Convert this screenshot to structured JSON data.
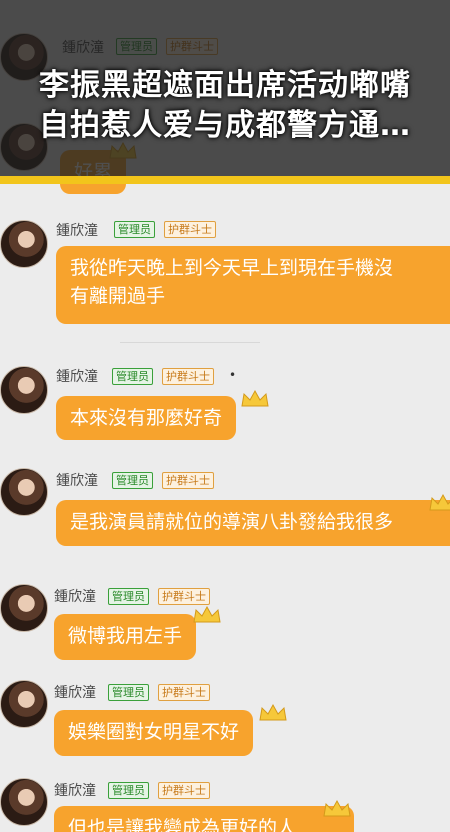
{
  "headline": {
    "line1": "李振黑超遮面出席活动嘟嘴",
    "line2": "自拍惹人爱与成都警方通…"
  },
  "sender": {
    "name": "鍾欣潼",
    "badge_admin": "管理员",
    "badge_fan": "护群斗士"
  },
  "messages": [
    {
      "text": "好累"
    },
    {
      "line1": "我從昨天晚上到今天早上到現在手機沒",
      "line2": "有離開過手"
    },
    {
      "text": "本來沒有那麼好奇"
    },
    {
      "text": "是我演員請就位的導演八卦發給我很多"
    },
    {
      "text": "微博我用左手"
    },
    {
      "text": "娛樂圈對女明星不好"
    },
    {
      "text": "但也是讓我變成為更好的人"
    }
  ],
  "colors": {
    "bubble": "#f7a32d",
    "headline_bar": "#f2c51b",
    "admin_badge": "#3aa03a",
    "fan_badge": "#e0a040"
  },
  "icons": [
    "avatar",
    "crown-icon"
  ]
}
